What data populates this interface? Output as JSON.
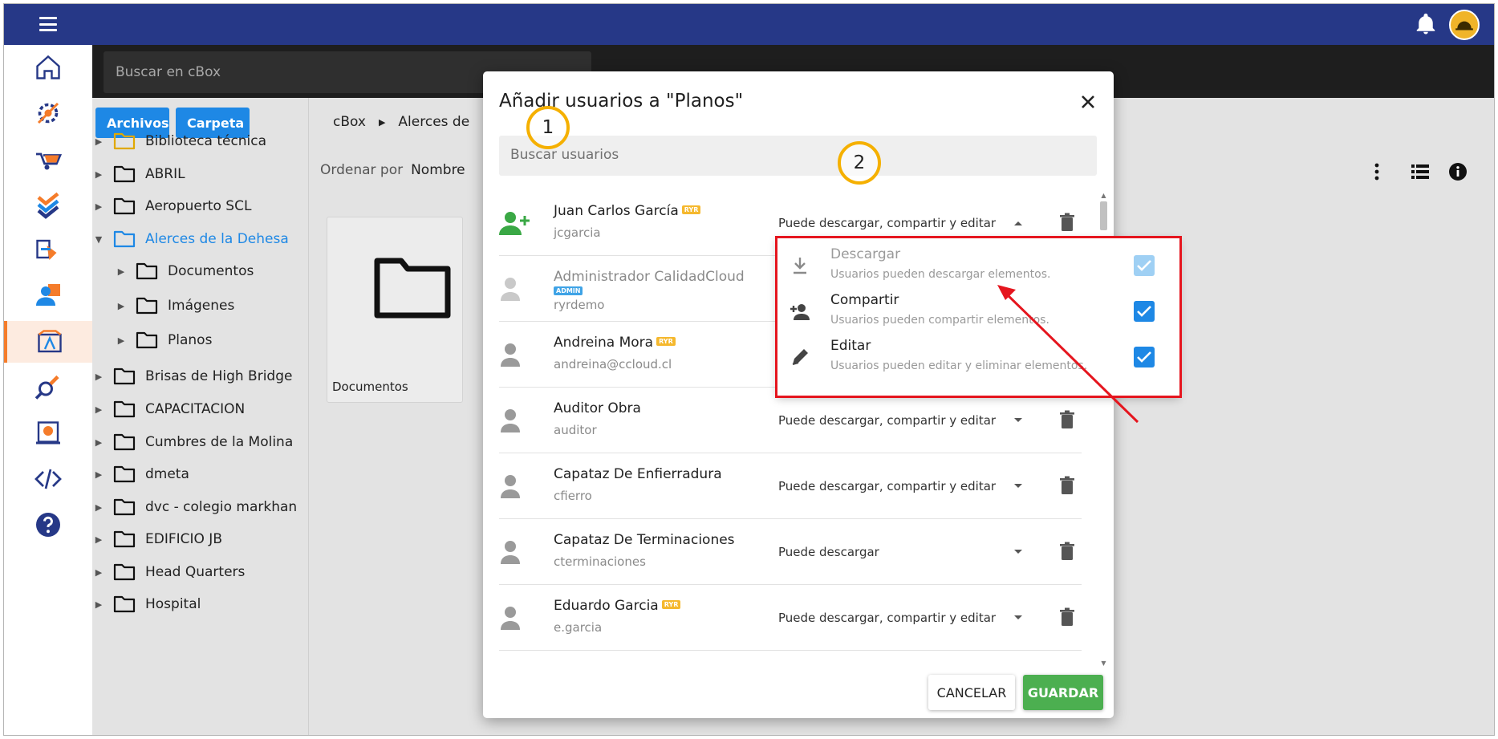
{
  "topbar": {
    "menu_icon": "hamburger-icon",
    "bell_icon": "bell-icon",
    "avatar_icon": "company-logo"
  },
  "rail": {
    "items": [
      {
        "name": "home-icon"
      },
      {
        "name": "settings-gear-icon"
      },
      {
        "name": "wheelbarrow-icon"
      },
      {
        "name": "checklist-icon"
      },
      {
        "name": "transfer-icon"
      },
      {
        "name": "people-icon"
      },
      {
        "name": "cbox-icon",
        "active": true
      },
      {
        "name": "inspection-icon"
      },
      {
        "name": "budget-icon"
      },
      {
        "name": "code-icon"
      },
      {
        "name": "help-icon"
      }
    ],
    "active_color": "#f57c2a"
  },
  "search": {
    "placeholder": "Buscar en cBox"
  },
  "tree": {
    "upload_files_label": "Archivos",
    "upload_folder_label": "Carpeta",
    "items": [
      {
        "label": "Biblioteca técnica",
        "depth": 0
      },
      {
        "label": "ABRIL",
        "depth": 0
      },
      {
        "label": "Aeropuerto SCL",
        "depth": 0
      },
      {
        "label": "Alerces de la Dehesa",
        "depth": 0,
        "expanded": true,
        "selected": true
      },
      {
        "label": "Documentos",
        "depth": 1
      },
      {
        "label": "Imágenes",
        "depth": 1
      },
      {
        "label": "Planos",
        "depth": 1
      },
      {
        "label": "Brisas de High Bridge",
        "depth": 0
      },
      {
        "label": "CAPACITACION",
        "depth": 0
      },
      {
        "label": "Cumbres de la Molina",
        "depth": 0
      },
      {
        "label": "dmeta",
        "depth": 0
      },
      {
        "label": "dvc - colegio markhan",
        "depth": 0
      },
      {
        "label": "EDIFICIO JB",
        "depth": 0
      },
      {
        "label": "Head Quarters",
        "depth": 0
      },
      {
        "label": "Hospital",
        "depth": 0
      }
    ]
  },
  "content": {
    "breadcrumb": [
      "cBox",
      "Alerces de"
    ],
    "sort_label": "Ordenar por",
    "sort_value": "Nombre",
    "card_label": "Documentos"
  },
  "modal": {
    "title": "Añadir usuarios a \"Planos\"",
    "search_placeholder": "Buscar usuarios",
    "users": [
      {
        "name": "Juan Carlos García",
        "tag": "RYR",
        "login": "jcgarcia",
        "permission": "Puede descargar, compartir y editar",
        "icon": "person-add-icon",
        "open": true
      },
      {
        "name": "Administrador CalidadCloud",
        "tag": "ADMIN",
        "login": "ryrdemo",
        "permission": "",
        "icon": "person-icon",
        "muted": true
      },
      {
        "name": "Andreina Mora",
        "tag": "RYR",
        "login": "andreina@ccloud.cl",
        "permission": "",
        "icon": "person-icon"
      },
      {
        "name": "Auditor Obra",
        "tag": "",
        "login": "auditor",
        "permission": "Puede descargar, compartir y editar",
        "icon": "person-icon"
      },
      {
        "name": "Capataz De Enfierradura",
        "tag": "",
        "login": "cfierro",
        "permission": "Puede descargar, compartir y editar",
        "icon": "person-icon"
      },
      {
        "name": "Capataz De Terminaciones",
        "tag": "",
        "login": "cterminaciones",
        "permission": "Puede descargar",
        "icon": "person-icon"
      },
      {
        "name": "Eduardo Garcia",
        "tag": "RYR",
        "login": "e.garcia",
        "permission": "Puede descargar, compartir y editar",
        "icon": "person-icon"
      }
    ],
    "cancel_label": "CANCELAR",
    "save_label": "GUARDAR"
  },
  "permissions_menu": {
    "options": [
      {
        "title": "Descargar",
        "desc": "Usuarios pueden descargar elementos.",
        "icon": "download-icon",
        "checked": true,
        "disabled": true
      },
      {
        "title": "Compartir",
        "desc": "Usuarios pueden compartir elementos.",
        "icon": "person-add-icon",
        "checked": true,
        "disabled": false
      },
      {
        "title": "Editar",
        "desc": "Usuarios pueden editar y eliminar elementos.",
        "icon": "pencil-icon",
        "checked": true,
        "disabled": false
      }
    ]
  },
  "annotations": {
    "step1": "1",
    "step2": "2",
    "highlight_color": "#e5151e",
    "badge_color": "#f5b000"
  },
  "colors": {
    "topbar": "#263887",
    "primary": "#1e88e5",
    "save": "#4caf50",
    "ryr_tag": "#f5b82e",
    "admin_tag": "#3fa3e6"
  }
}
